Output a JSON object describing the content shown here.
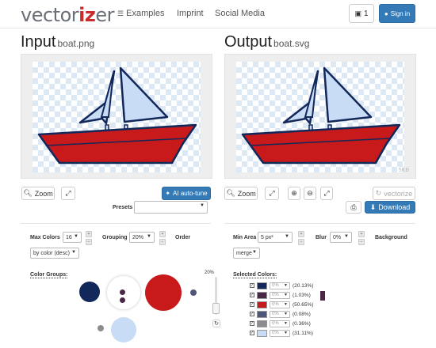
{
  "header": {
    "logo_main": "vector",
    "logo_accent": "iz",
    "logo_end": "er",
    "nav": [
      {
        "label": "Examples"
      },
      {
        "label": "Imprint"
      },
      {
        "label": "Social Media"
      }
    ],
    "gallery_count": "1",
    "sign_in_label": "Sign in"
  },
  "input": {
    "title": "Input",
    "filename": "boat.png",
    "zoom_label": "Zoom",
    "ai_label": "AI auto-tune",
    "presets_label": "Presets",
    "presets_value": ""
  },
  "output": {
    "title": "Output",
    "filename": "boat.svg",
    "size_label": "5KB",
    "zoom_label": "Zoom",
    "vectorize_label": "vectorize",
    "download_label": "Download"
  },
  "settings_left": {
    "max_colors_label": "Max Colors",
    "max_colors_value": "16",
    "grouping_label": "Grouping",
    "grouping_value": "20%",
    "order_label": "Order",
    "order_value": "by color (desc)",
    "color_groups_label": "Color Groups:",
    "slider_label": "20%"
  },
  "settings_right": {
    "min_area_label": "Min Area",
    "min_area_value": "5 px²",
    "blur_label": "Blur",
    "blur_value": "0%",
    "background_label": "Background",
    "mode_value": "merge",
    "selected_colors_label": "Selected Colors:"
  },
  "colors": [
    {
      "hex": "#13285a",
      "pct_input": "0%",
      "share": "(20.13%)"
    },
    {
      "hex": "#4a2745",
      "pct_input": "0%",
      "share": "(1.03%)"
    },
    {
      "hex": "#c81a1a",
      "pct_input": "0%",
      "share": "(50.65%)"
    },
    {
      "hex": "#4f5778",
      "pct_input": "0%",
      "share": "(0.08%)"
    },
    {
      "hex": "#8c8c90",
      "pct_input": "0%",
      "share": "(0.36%)"
    },
    {
      "hex": "#c8dcf5",
      "pct_input": "0%",
      "share": "(31.11%)"
    }
  ],
  "accent": "#337ab7"
}
